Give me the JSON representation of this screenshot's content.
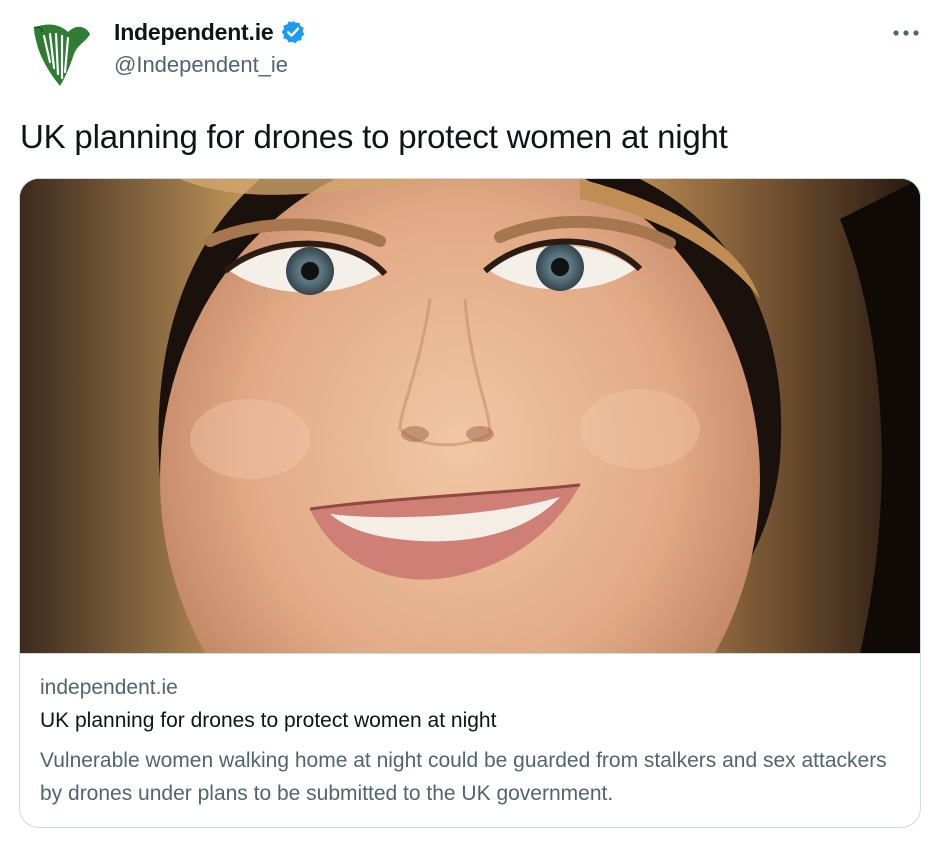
{
  "author": {
    "display_name": "Independent.ie",
    "handle": "@Independent_ie",
    "verified": true,
    "avatar_icon": "harp-logo-icon"
  },
  "tweet": {
    "text": "UK planning for drones to protect women at night"
  },
  "card": {
    "image_alt_icon": "portrait-photo",
    "domain": "independent.ie",
    "title": "UK planning for drones to protect women at night",
    "description": "Vulnerable women walking home at night could be guarded from stalkers and sex attackers by drones under plans to be submitted to the UK government."
  },
  "colors": {
    "brand_green": "#2e7d32",
    "verified_blue": "#1d9bf0",
    "text_primary": "#0f1419",
    "text_secondary": "#536471",
    "border": "#cfd9de"
  }
}
